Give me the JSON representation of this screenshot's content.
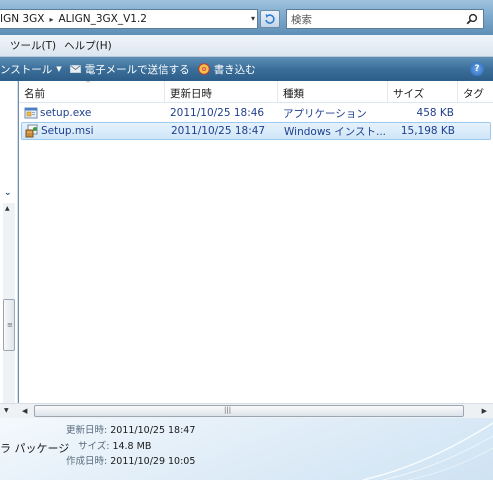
{
  "address": {
    "crumbs": [
      "IGN 3GX",
      "ALIGN_3GX_V1.2"
    ],
    "separator": "▸",
    "dropdown_glyph": "▾"
  },
  "search": {
    "placeholder": "検索"
  },
  "menu": [
    "ツール(T)",
    "ヘルプ(H)"
  ],
  "commandbar": {
    "install_label": "ンストール",
    "email_label": "電子メールで送信する",
    "burn_label": "書き込む",
    "help_label": "?"
  },
  "columns": {
    "name": "名前",
    "date": "更新日時",
    "type": "種類",
    "size": "サイズ",
    "tag": "タグ"
  },
  "files": [
    {
      "name": "setup.exe",
      "date": "2011/10/25 18:46",
      "type": "アプリケーション",
      "size": "458 KB",
      "icon": "application-icon",
      "selected": false
    },
    {
      "name": "Setup.msi",
      "date": "2011/10/25 18:47",
      "type": "Windows インスト...",
      "size": "15,198 KB",
      "icon": "installer-package-icon",
      "selected": true
    }
  ],
  "details": {
    "type_text": "ラ パッケージ",
    "modified_label": "更新日時:",
    "modified_value": "2011/10/25 18:47",
    "size_label": "サイズ:",
    "size_value": "14.8 MB",
    "created_label": "作成日時:",
    "created_value": "2011/10/29 10:05"
  },
  "colors": {
    "command_bar": "#3b6f9a",
    "selection": "#cfe6f9",
    "file_text": "#1f3f8f"
  }
}
